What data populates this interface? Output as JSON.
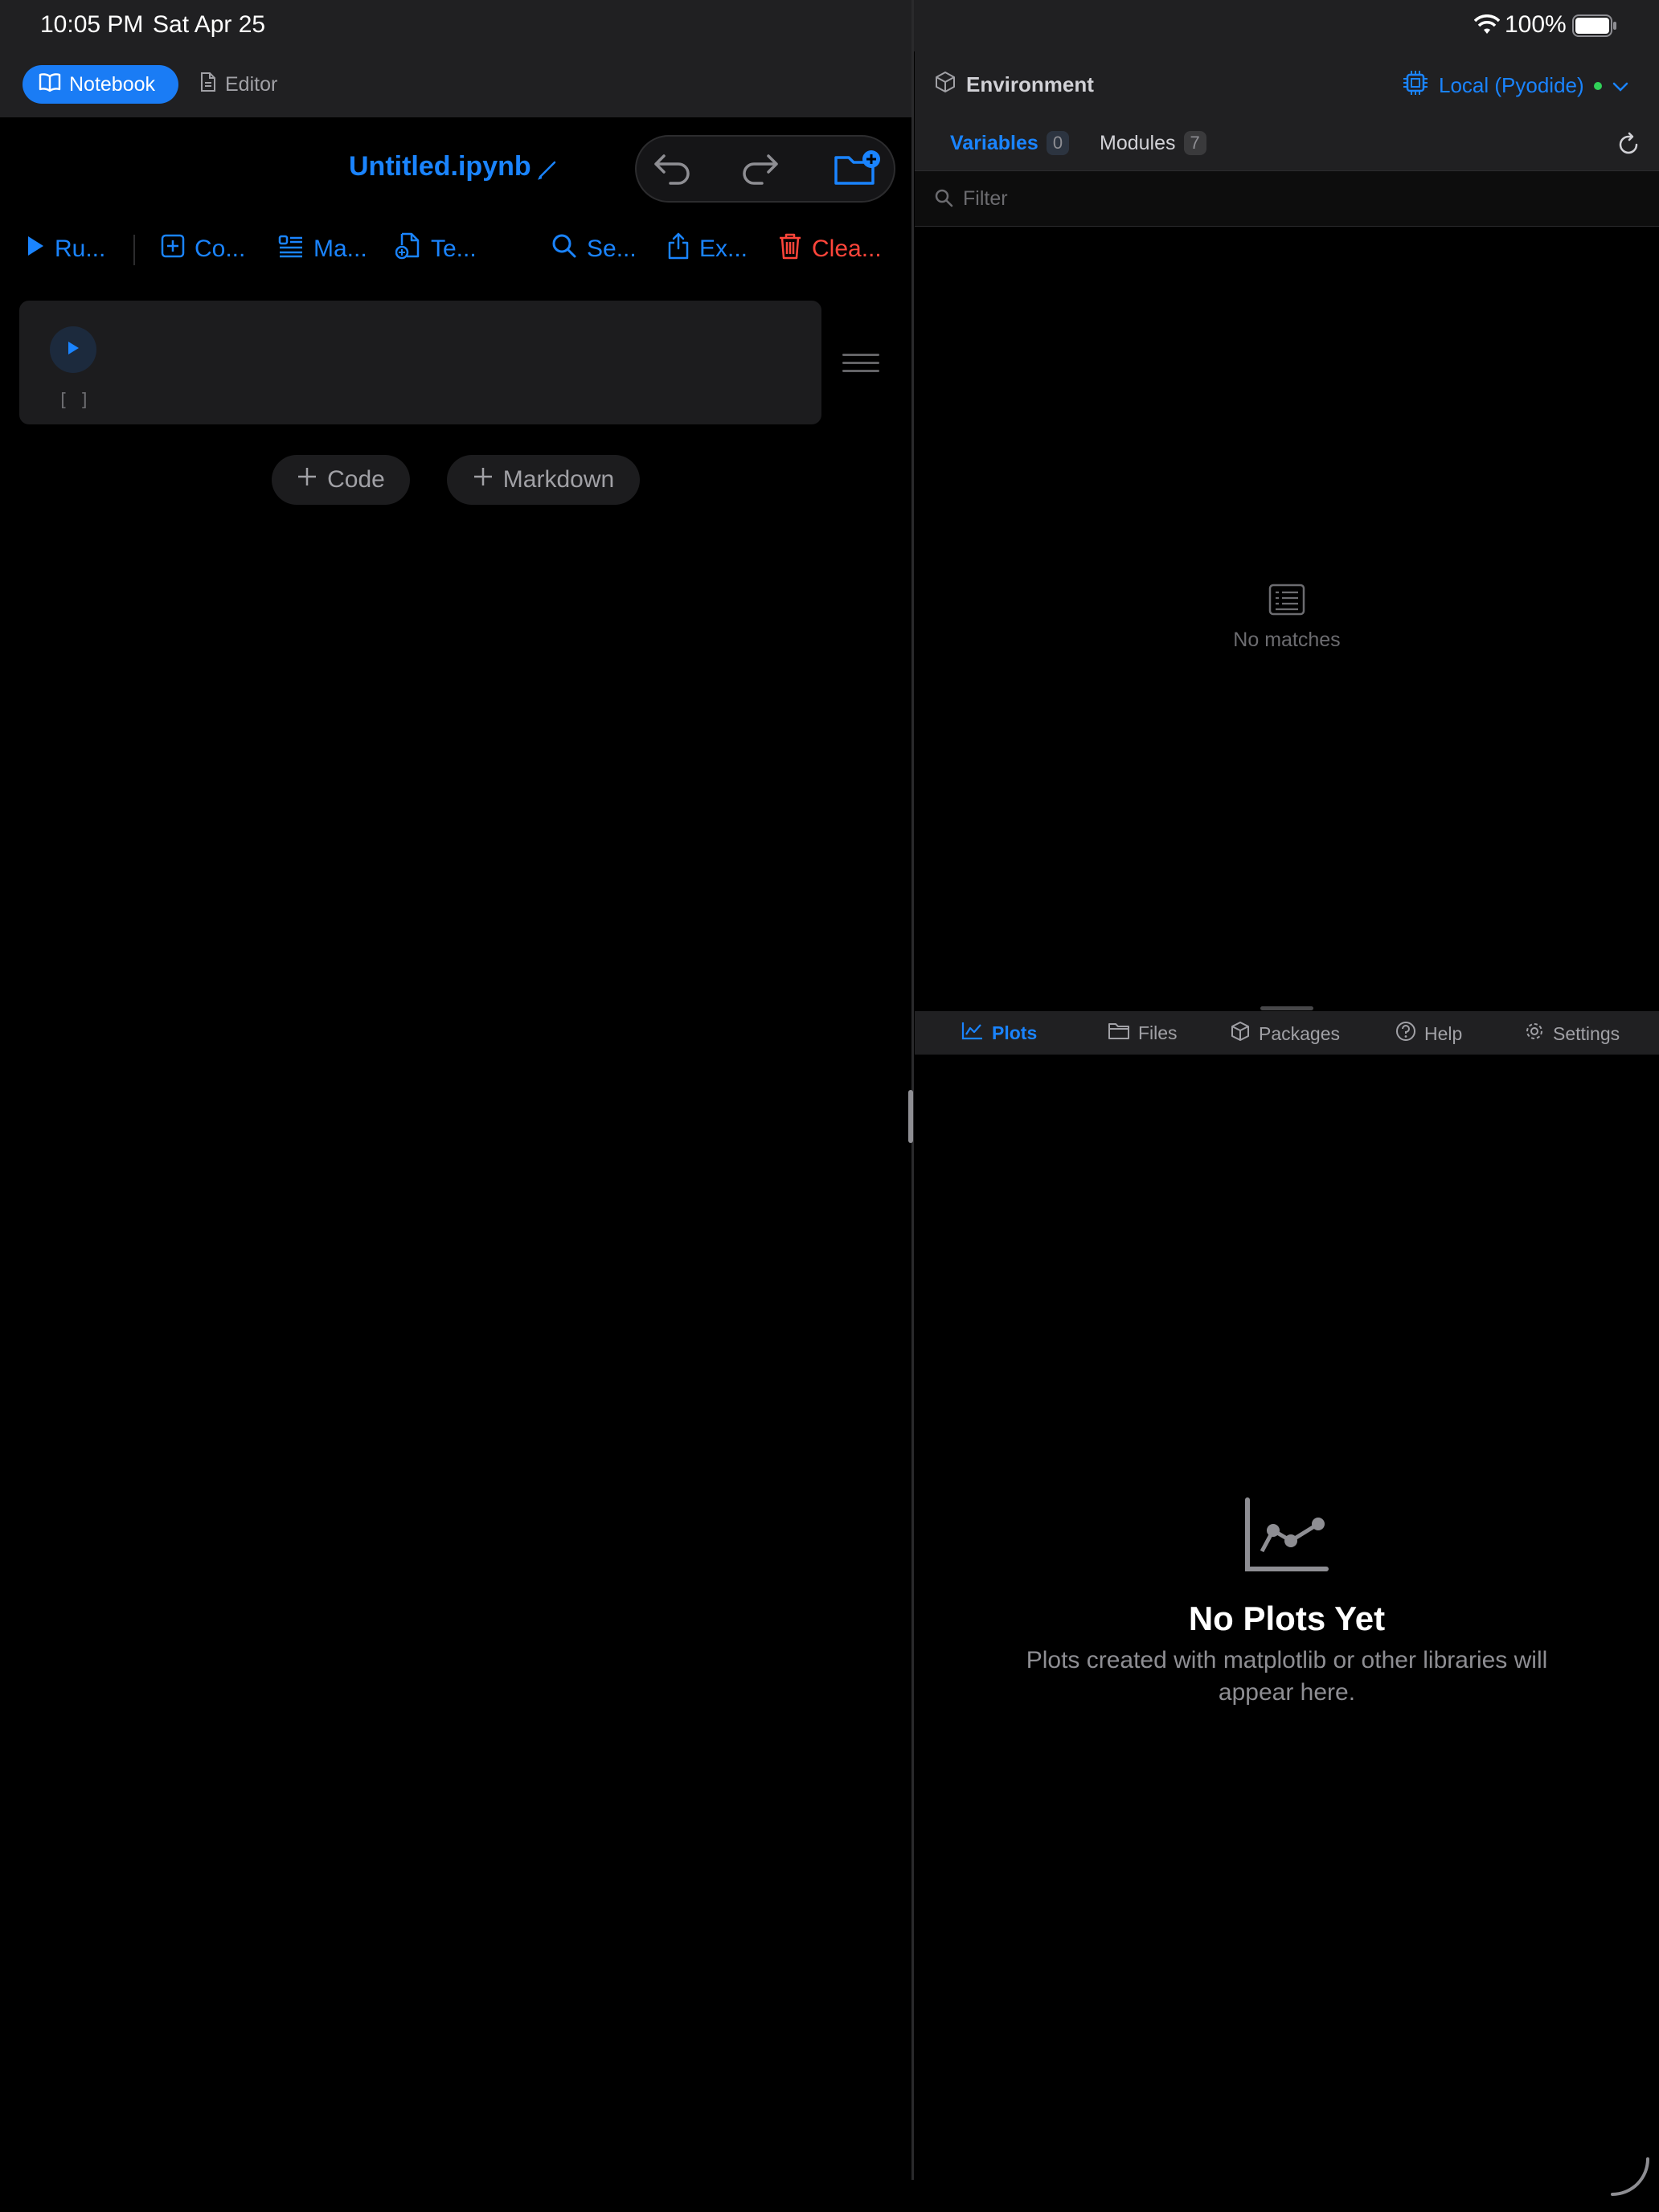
{
  "status_bar": {
    "time": "10:05 PM",
    "date": "Sat Apr 25",
    "battery": "100%"
  },
  "left_header": {
    "notebook_label": "Notebook",
    "editor_label": "Editor"
  },
  "notebook": {
    "title": "Untitled.ipynb"
  },
  "toolbar": {
    "run_label": "Ru...",
    "code_label": "Co...",
    "markdown_label": "Ma...",
    "template_label": "Te...",
    "search_label": "Se...",
    "export_label": "Ex...",
    "clear_label": "Clea..."
  },
  "cell": {
    "execution_count": "[ ]"
  },
  "add_buttons": {
    "code": "Code",
    "markdown": "Markdown"
  },
  "environment": {
    "title": "Environment",
    "kernel": "Local (Pyodide)",
    "kernel_status_color": "#30d158",
    "tabs": [
      {
        "label": "Variables",
        "count": "0"
      },
      {
        "label": "Modules",
        "count": "7"
      }
    ],
    "filter_placeholder": "Filter",
    "empty_text": "No matches"
  },
  "bottom_tabs": [
    {
      "label": "Plots",
      "icon": "chart-icon"
    },
    {
      "label": "Files",
      "icon": "folder-icon"
    },
    {
      "label": "Packages",
      "icon": "package-icon"
    },
    {
      "label": "Help",
      "icon": "help-icon"
    },
    {
      "label": "Settings",
      "icon": "gear-icon"
    }
  ],
  "plots": {
    "empty_title": "No Plots Yet",
    "empty_desc": "Plots created with matplotlib or other libraries will appear here."
  },
  "colors": {
    "accent": "#1a84ff",
    "danger": "#ff453a",
    "background": "#000000",
    "panel": "#202022"
  }
}
